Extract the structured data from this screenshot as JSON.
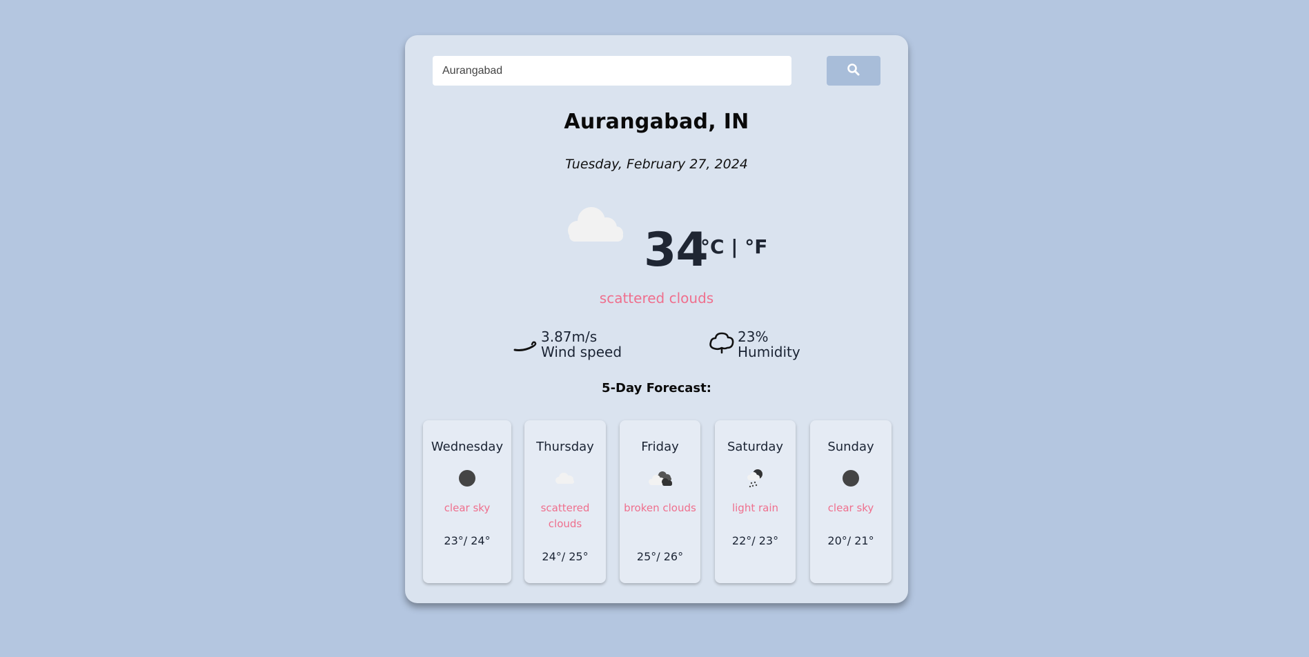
{
  "search": {
    "value": "Aurangabad",
    "button_icon": "search-icon"
  },
  "location": {
    "city": "Aurangabad, IN",
    "date": "Tuesday, February 27, 2024"
  },
  "current": {
    "icon": "cloud-icon",
    "temperature": "34",
    "units": "°C | °F",
    "description": "scattered clouds",
    "wind": {
      "icon": "wind-icon",
      "value": "3.87m/s",
      "label": "Wind speed"
    },
    "humidity": {
      "icon": "humidity-cloud-icon",
      "value": "23%",
      "label": "Humidity"
    }
  },
  "forecast": {
    "title": "5-Day Forecast:",
    "days": [
      {
        "day": "Wednesday",
        "icon": "clear-night-icon",
        "description": "clear sky",
        "low": "23°/",
        "high": "24°"
      },
      {
        "day": "Thursday",
        "icon": "scattered-clouds-icon",
        "description": "scattered clouds",
        "low": "24°/",
        "high": "25°"
      },
      {
        "day": "Friday",
        "icon": "broken-clouds-icon",
        "description": "broken clouds",
        "low": "25°/",
        "high": "26°"
      },
      {
        "day": "Saturday",
        "icon": "light-rain-icon",
        "description": "light rain",
        "low": "22°/",
        "high": "23°"
      },
      {
        "day": "Sunday",
        "icon": "clear-night-icon",
        "description": "clear sky",
        "low": "20°/",
        "high": "21°"
      }
    ]
  },
  "colors": {
    "background": "#b4c6e0",
    "card": "#dae3ef",
    "accent": "#ef6f8d",
    "button": "#a8bdd9"
  }
}
